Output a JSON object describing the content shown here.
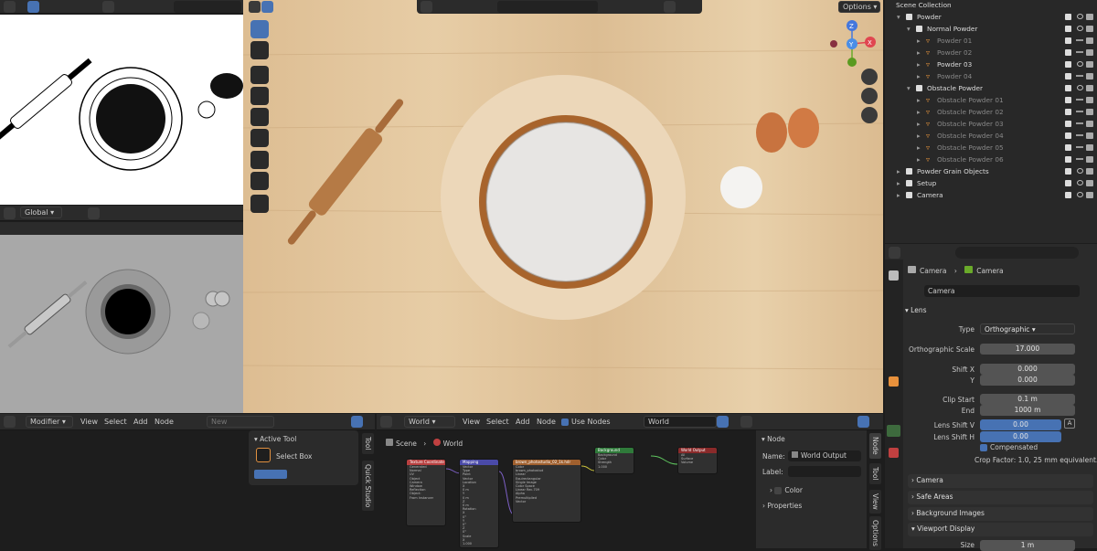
{
  "outliner": {
    "items": [
      {
        "label": "Scene Collection",
        "indent": 0,
        "arrow": "",
        "icon": "",
        "muted": false,
        "eye": false
      },
      {
        "label": "Powder",
        "indent": 1,
        "arrow": "▾",
        "icon": "box",
        "muted": false,
        "eye": true
      },
      {
        "label": "Normal Powder",
        "indent": 2,
        "arrow": "▾",
        "icon": "box",
        "muted": false,
        "eye": true
      },
      {
        "label": "Powder 01",
        "indent": 3,
        "arrow": "▸",
        "icon": "tri",
        "muted": true,
        "eye": false
      },
      {
        "label": "Powder 02",
        "indent": 3,
        "arrow": "▸",
        "icon": "tri",
        "muted": true,
        "eye": false
      },
      {
        "label": "Powder 03",
        "indent": 3,
        "arrow": "▸",
        "icon": "tri",
        "muted": false,
        "eye": true
      },
      {
        "label": "Powder 04",
        "indent": 3,
        "arrow": "▸",
        "icon": "tri",
        "muted": true,
        "eye": false
      },
      {
        "label": "Obstacle Powder",
        "indent": 2,
        "arrow": "▾",
        "icon": "box",
        "muted": false,
        "eye": true
      },
      {
        "label": "Obstacle Powder 01",
        "indent": 3,
        "arrow": "▸",
        "icon": "tri",
        "muted": true,
        "eye": false
      },
      {
        "label": "Obstacle Powder 02",
        "indent": 3,
        "arrow": "▸",
        "icon": "tri",
        "muted": true,
        "eye": false
      },
      {
        "label": "Obstacle Powder 03",
        "indent": 3,
        "arrow": "▸",
        "icon": "tri",
        "muted": true,
        "eye": false
      },
      {
        "label": "Obstacle Powder 04",
        "indent": 3,
        "arrow": "▸",
        "icon": "tri",
        "muted": true,
        "eye": false
      },
      {
        "label": "Obstacle Powder 05",
        "indent": 3,
        "arrow": "▸",
        "icon": "tri",
        "muted": true,
        "eye": false
      },
      {
        "label": "Obstacle Powder 06",
        "indent": 3,
        "arrow": "▸",
        "icon": "tri",
        "muted": true,
        "eye": false
      },
      {
        "label": "Powder Grain Objects",
        "indent": 1,
        "arrow": "▸",
        "icon": "box",
        "muted": false,
        "eye": true
      },
      {
        "label": "Setup",
        "indent": 1,
        "arrow": "▸",
        "icon": "box",
        "muted": false,
        "eye": true
      },
      {
        "label": "Camera",
        "indent": 1,
        "arrow": "▸",
        "icon": "box",
        "muted": false,
        "eye": true
      }
    ]
  },
  "viewport": {
    "options_label": "Options",
    "gizmo": {
      "x": "X",
      "y": "Y",
      "z": "Z"
    }
  },
  "left_viewport": {
    "orientation": "Global"
  },
  "bottom_left": {
    "mode": "Modifier",
    "menus": [
      "View",
      "Select",
      "Add",
      "Node"
    ],
    "new_label": "New"
  },
  "node_editor": {
    "world_dd": "World",
    "menus": [
      "View",
      "Select",
      "Add",
      "Node"
    ],
    "use_nodes": "Use Nodes",
    "world_name": "World",
    "breadcrumb": {
      "scene": "Scene",
      "world": "World"
    },
    "nodes": {
      "texcoord": "Texture Coordinate",
      "mapping": "Mapping",
      "image": "brown_photostudio_02_1k.hdr",
      "background": "Background",
      "output": "World Output"
    },
    "texcoord_rows": [
      "Generated",
      "Normal",
      "UV",
      "Object",
      "Camera",
      "Window",
      "Reflection"
    ],
    "texcoord_extra": [
      "Object:",
      "From Instancer"
    ],
    "mapping_rows": [
      "Vector",
      "Type",
      "Point",
      "Vector",
      "Location",
      "X",
      "0 m",
      "Y",
      "0 m",
      "Z",
      "0 m",
      "Rotation",
      "X",
      "0°",
      "Y",
      "0°",
      "Z",
      "0°",
      "Scale",
      "X",
      "1.000"
    ],
    "image_rows": [
      "Color",
      "brown_photostud",
      "Linear",
      "Equirectangular",
      "Single Image",
      "Color Space",
      "Linear Rec.709",
      "Alpha",
      "Premultiplied",
      "Vector"
    ],
    "bg_rows": [
      "Background",
      "Color",
      "Strength",
      "1.000"
    ],
    "out_rows": [
      "All",
      "Surface",
      "Volume"
    ]
  },
  "active_tool": {
    "title": "Active Tool",
    "tool": "Select Box"
  },
  "side_tabs": {
    "tool": "Tool",
    "quick": "Quick Studio",
    "node": "Node",
    "tool2": "Tool",
    "view": "View",
    "options": "Options"
  },
  "node_panel": {
    "title": "Node",
    "name_label": "Name:",
    "name_value": "World Output",
    "label_label": "Label:",
    "color": "Color",
    "properties": "Properties"
  },
  "properties": {
    "breadcrumb": [
      "Camera",
      "Camera"
    ],
    "datablock": "Camera",
    "lens": "Lens",
    "fields": [
      {
        "label": "Type",
        "value": "Orthographic",
        "dropdown": true,
        "blue": false
      },
      {
        "label": "Orthographic Scale",
        "value": "17.000",
        "dropdown": false,
        "blue": false
      },
      {
        "label": "Shift X",
        "value": "0.000",
        "dropdown": false,
        "blue": false
      },
      {
        "label": "Y",
        "value": "0.000",
        "dropdown": false,
        "blue": false
      },
      {
        "label": "Clip Start",
        "value": "0.1 m",
        "dropdown": false,
        "blue": false
      },
      {
        "label": "End",
        "value": "1000 m",
        "dropdown": false,
        "blue": false
      },
      {
        "label": "Lens Shift V",
        "value": "0.00",
        "dropdown": false,
        "blue": true
      },
      {
        "label": "Lens Shift H",
        "value": "0.00",
        "dropdown": false,
        "blue": true
      }
    ],
    "compensated": "Compensated",
    "crop_factor": "Crop Factor: 1.0, 25 mm equivalent.",
    "sections": [
      "Camera",
      "Safe Areas",
      "Background Images",
      "Viewport Display"
    ],
    "size_label": "Size",
    "size_value": "1 m",
    "a_key": "A"
  },
  "colors": {
    "accent": "#4772b3",
    "wood": "#e2c59d",
    "panel": "#2b2b2b"
  }
}
